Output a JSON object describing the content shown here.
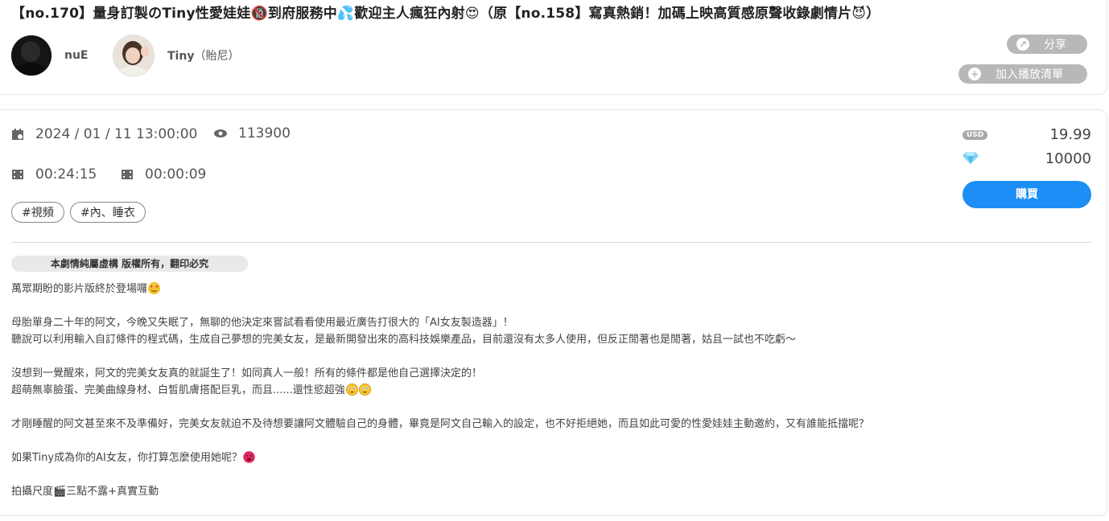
{
  "title": "【no.170】量身訂製のTiny性愛娃娃🔞到府服務中💦歡迎主人瘋狂內射😍（原【no.158】寫真熱銷！加碼上映高質感原聲收錄劇情片😈）",
  "creators": [
    {
      "name": "nuE",
      "sub": ""
    },
    {
      "name": "Tiny",
      "sub": "（貽尼）"
    }
  ],
  "actions": {
    "share": "分享",
    "playlist": "加入播放清單"
  },
  "meta": {
    "date": "2024 / 01 / 11 13:00:00",
    "views": "113900",
    "duration": "00:24:15",
    "preview": "00:00:09"
  },
  "tags": [
    "#視頻",
    "#內、睡衣"
  ],
  "notice": "本劇情純屬虛構 版權所有，翻印必究",
  "description": [
    "萬眾期盼的影片版終於登場囉",
    "",
    "母胎單身二十年的阿文，今晚又失眠了，無聊的他決定來嘗試看看使用最近廣告打很大的「AI女友製造器」！",
    "聽說可以利用輸入自訂條件的程式碼，生成自己夢想的完美女友，是最新開發出來的高科技娛樂產品，目前還沒有太多人使用，但反正閒著也是閒著，姑且一試也不吃虧～",
    "",
    "沒想到一覺醒來，阿文的完美女友真的就誕生了！如同真人一般！所有的條件都是他自己選擇決定的！",
    "超萌無辜臉蛋、完美曲線身材、白皙肌膚搭配巨乳，而且......還性慾超強",
    "",
    "才剛睡醒的阿文甚至來不及準備好，完美女友就迫不及待想要讓阿文體驗自己的身體，畢竟是阿文自己輸入的設定，也不好拒絕她，而且如此可愛的性愛娃娃主動邀約，又有誰能抵擋呢？",
    "",
    "如果Tiny成為你的AI女友，你打算怎麼使用她呢？",
    "",
    "拍攝尺度🎬三點不露+真實互動"
  ],
  "price": {
    "currency": "USD",
    "usd": "19.99",
    "diamond": "10000"
  },
  "buy_label": "購買",
  "colors": {
    "accent": "#1c8ef5",
    "pill": "#b8b8b8"
  }
}
